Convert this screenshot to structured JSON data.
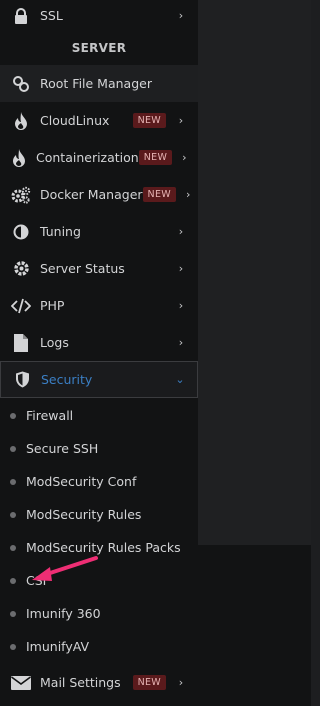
{
  "colors": {
    "accent": "#3b7fc4",
    "badge_bg": "#5a1a1c",
    "arrow": "#ee2e74"
  },
  "sidebar": {
    "top_item": {
      "label": "SSL",
      "icon": "lock-icon"
    },
    "section_header": "SERVER",
    "items": [
      {
        "label": "Root File Manager",
        "icon": "link-icon"
      },
      {
        "label": "CloudLinux",
        "icon": "flame-icon",
        "badge": "NEW"
      },
      {
        "label": "Containerization",
        "icon": "flame-icon",
        "badge": "NEW"
      },
      {
        "label": "Docker Manager",
        "icon": "gears-icon",
        "badge": "NEW"
      },
      {
        "label": "Tuning",
        "icon": "contrast-icon"
      },
      {
        "label": "Server Status",
        "icon": "gear-icon"
      },
      {
        "label": "PHP",
        "icon": "code-icon"
      },
      {
        "label": "Logs",
        "icon": "file-icon"
      },
      {
        "label": "Security",
        "icon": "shield-icon"
      }
    ],
    "security_submenu": [
      "Firewall",
      "Secure SSH",
      "ModSecurity Conf",
      "ModSecurity Rules",
      "ModSecurity Rules Packs",
      "CSF",
      "Imunify 360",
      "ImunifyAV"
    ],
    "bottom_item": {
      "label": "Mail Settings",
      "icon": "envelope-icon",
      "badge": "NEW"
    }
  }
}
